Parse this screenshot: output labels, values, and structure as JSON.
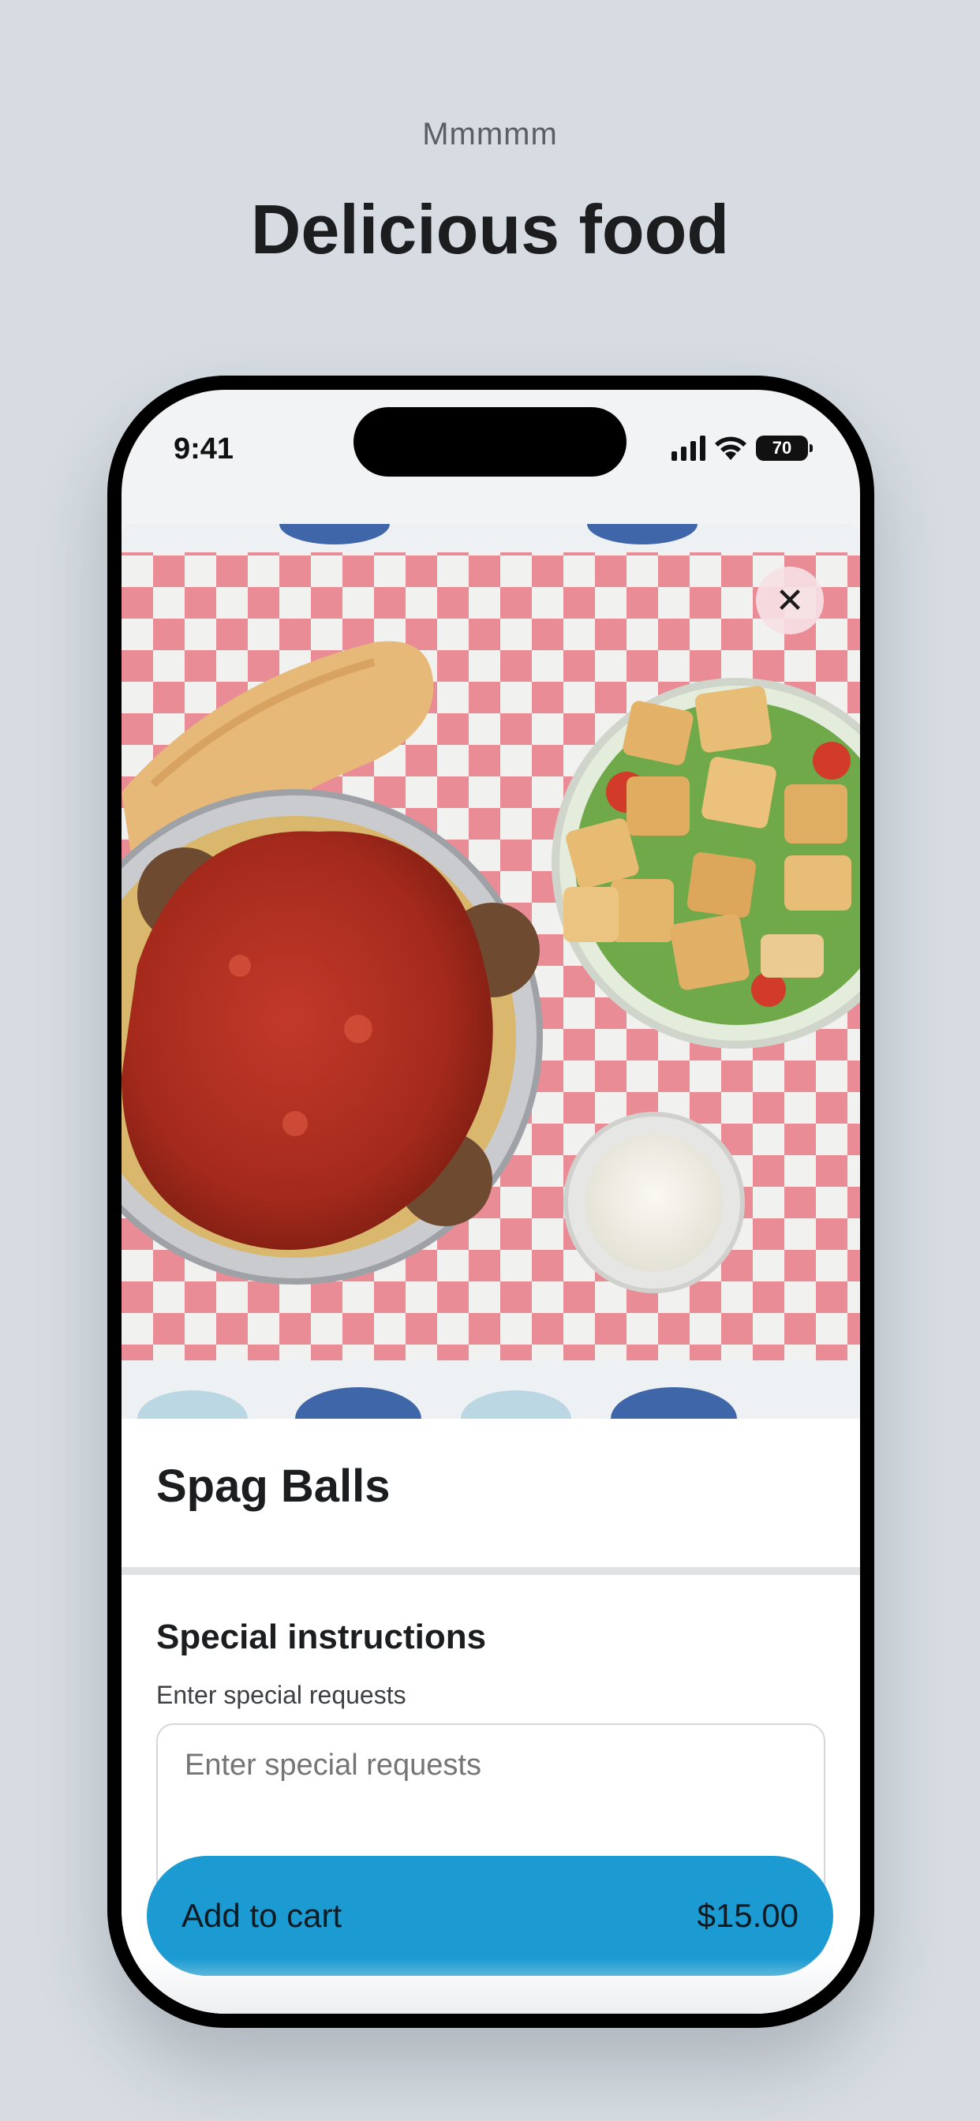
{
  "header": {
    "eyebrow": "Mmmmm",
    "headline": "Delicious food"
  },
  "status_bar": {
    "time": "9:41",
    "battery": "70",
    "icons": [
      "signal-icon",
      "wifi-icon",
      "battery-icon"
    ]
  },
  "item": {
    "image": "food-photo-spaghetti-meatballs-salad-breadstick",
    "close_icon": "close-icon",
    "close_glyph": "✕",
    "title": "Spag Balls"
  },
  "instructions": {
    "title": "Special instructions",
    "label": "Enter special requests",
    "placeholder": "Enter special requests"
  },
  "cart": {
    "label": "Add to cart",
    "price": "$15.00"
  },
  "colors": {
    "background": "#d6dce2",
    "accent": "#1b9bd1",
    "close_button": "#f6e0e4"
  }
}
